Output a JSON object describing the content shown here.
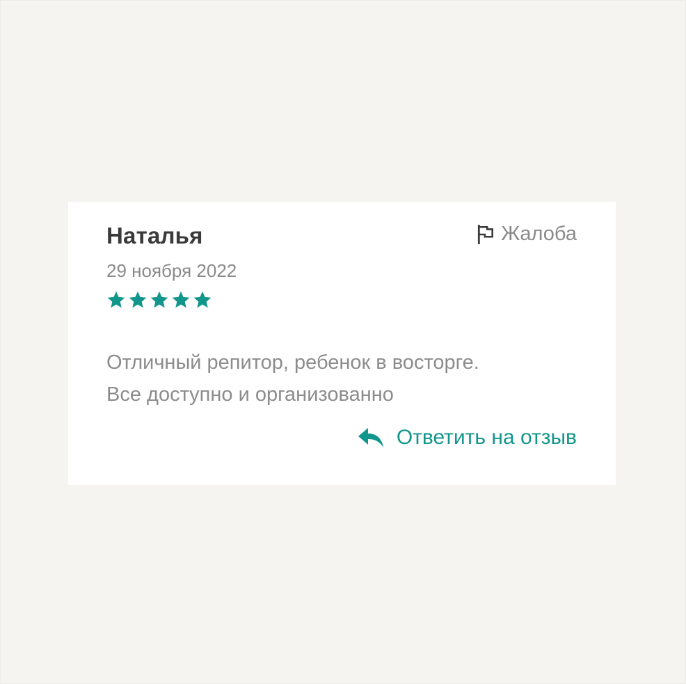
{
  "review": {
    "author": "Наталья",
    "date": "29 ноября 2022",
    "rating": 5,
    "rating_max": 5,
    "text_lines": [
      "Отличный репитор, ребенок в восторге.",
      "Все доступно и организованно"
    ],
    "complaint_label": "Жалоба",
    "reply_label": "Ответить на отзыв"
  },
  "icons": {
    "star": "star-icon",
    "complaint": "flag-icon",
    "reply": "reply-arrow-icon"
  },
  "colors": {
    "accent": "#12968c",
    "background": "#f5f4f1",
    "card": "#ffffff",
    "author_text": "#3a3a3a",
    "muted_text": "#8a8a8a"
  }
}
